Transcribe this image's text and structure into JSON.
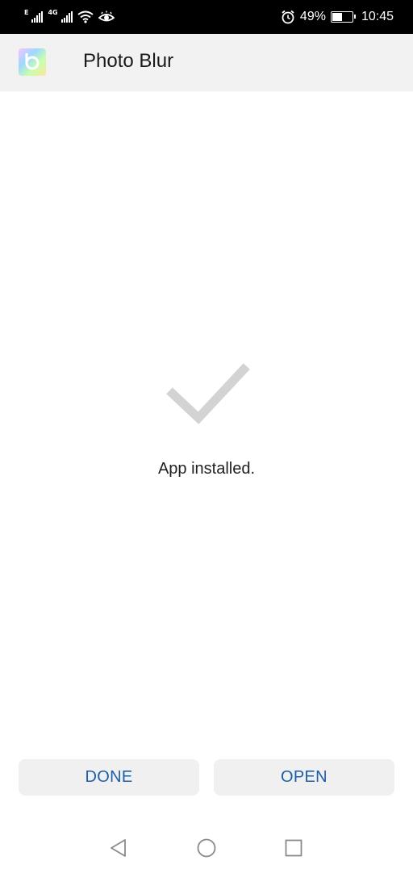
{
  "status_bar": {
    "network_type_1": "E",
    "network_type_2": "4G",
    "battery_percent": "49%",
    "time": "10:45",
    "icons": [
      "signal-icon",
      "signal-icon",
      "wifi-icon",
      "eye-comfort-icon",
      "alarm-icon",
      "battery-charging-icon"
    ],
    "battery_level": 0.49
  },
  "header": {
    "app_icon": "photo-blur-app-icon",
    "title": "Photo Blur"
  },
  "main": {
    "status_icon": "checkmark-icon",
    "message": "App installed."
  },
  "actions": {
    "done_label": "DONE",
    "open_label": "OPEN"
  },
  "nav_bar": {
    "icons": [
      "back-icon",
      "home-icon",
      "recents-icon"
    ]
  },
  "colors": {
    "status_bar_bg": "#000000",
    "header_bg": "#f2f2f2",
    "button_bg": "#f0f0f0",
    "button_text": "#1c5fa8",
    "checkmark": "#d3d3d3"
  }
}
